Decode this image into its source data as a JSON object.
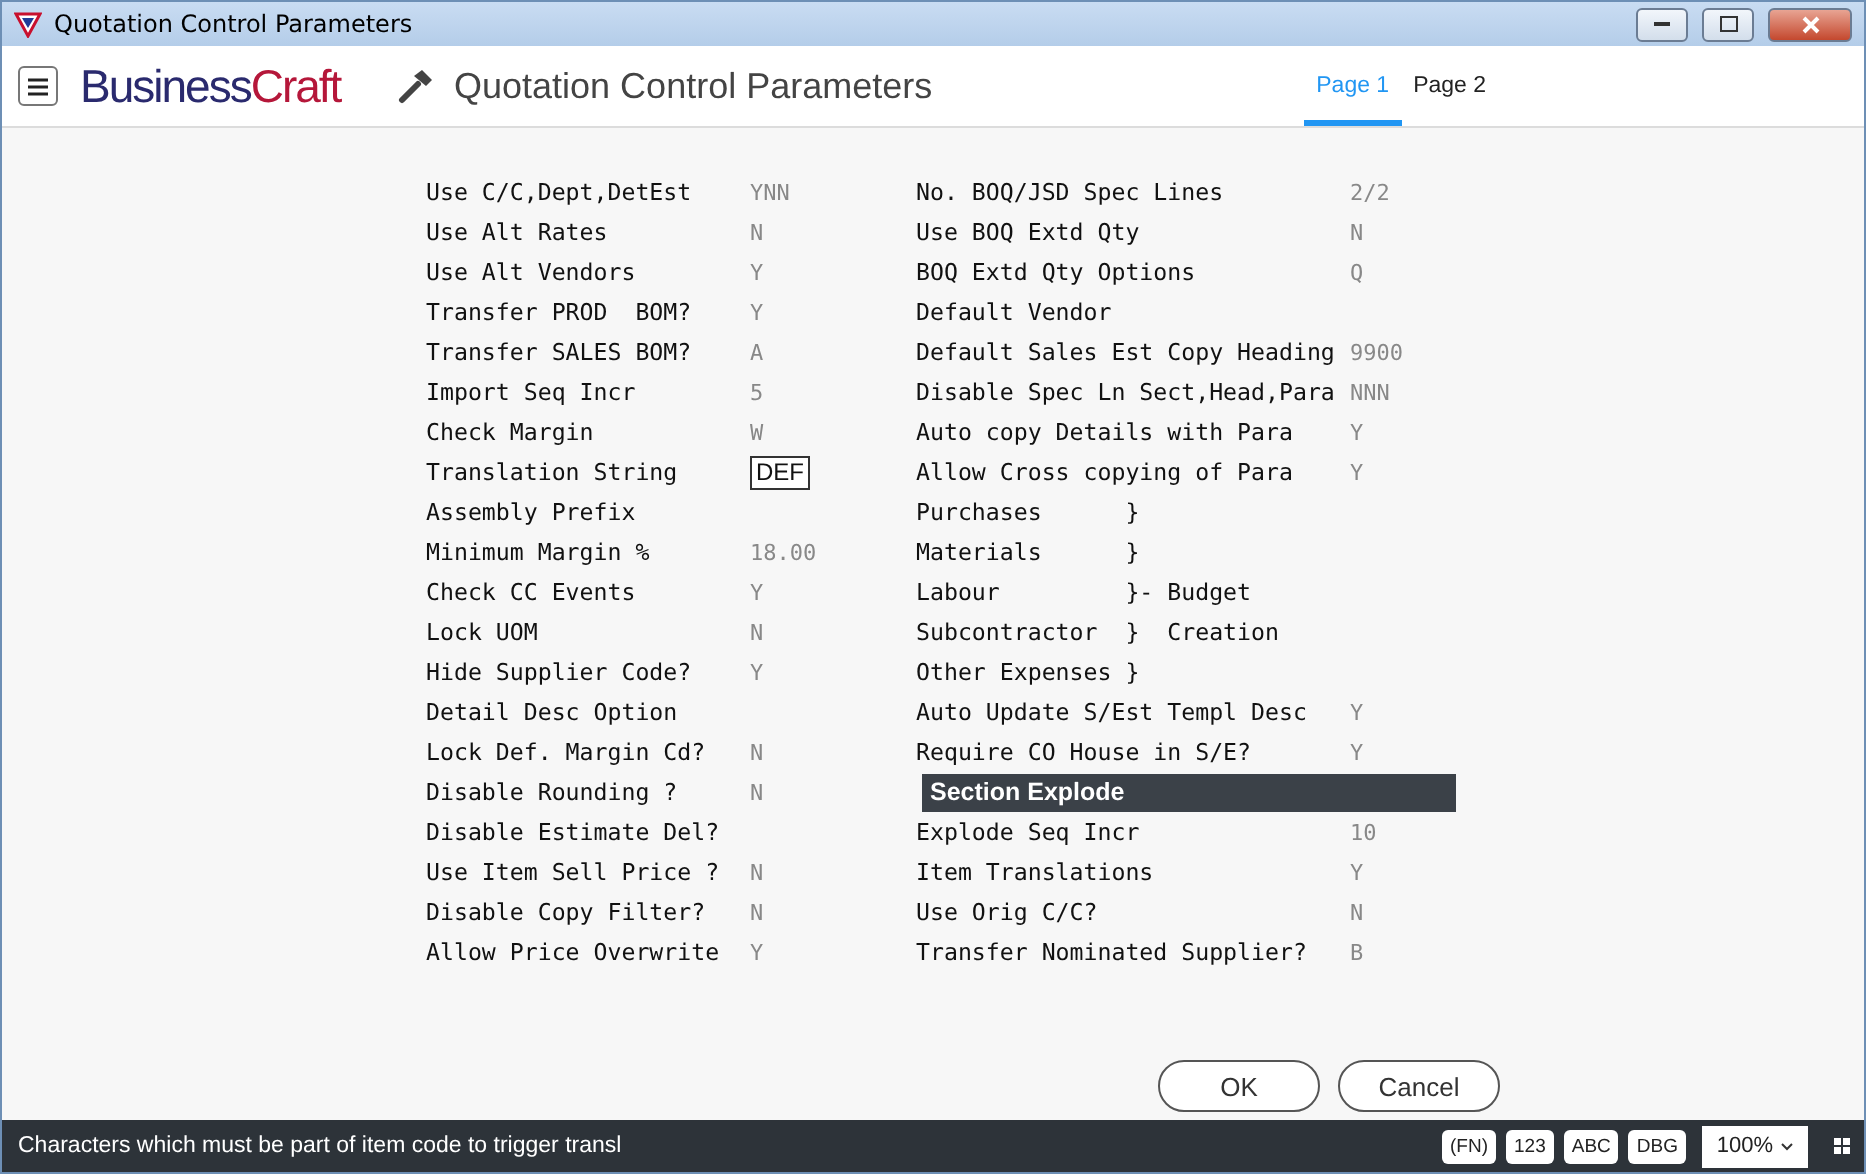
{
  "window": {
    "title": "Quotation Control Parameters"
  },
  "header": {
    "brand_first": "Business",
    "brand_second": "Craft",
    "title": "Quotation Control Parameters"
  },
  "tabs": [
    {
      "label": "Page 1",
      "selected": true
    },
    {
      "label": "Page 2",
      "selected": false
    }
  ],
  "left_rows": [
    {
      "kind": "param",
      "label": "Use C/C,Dept,DetEst",
      "value": "YNN"
    },
    {
      "kind": "param",
      "label": "Use Alt Rates",
      "value": "N"
    },
    {
      "kind": "param",
      "label": "Use Alt Vendors",
      "value": "Y"
    },
    {
      "kind": "param",
      "label": "Transfer PROD  BOM?",
      "value": "Y"
    },
    {
      "kind": "param",
      "label": "Transfer SALES BOM?",
      "value": "A"
    },
    {
      "kind": "param",
      "label": "Import Seq Incr",
      "value": "5"
    },
    {
      "kind": "param",
      "label": "Check Margin",
      "value": "W"
    },
    {
      "kind": "field",
      "label": "Translation String",
      "value": "DEF"
    },
    {
      "kind": "param",
      "label": "Assembly Prefix"
    },
    {
      "kind": "param",
      "label": "Minimum Margin %",
      "value": "18.00"
    },
    {
      "kind": "param",
      "label": "Check CC Events",
      "value": "Y"
    },
    {
      "kind": "param",
      "label": "Lock UOM",
      "value": "N"
    },
    {
      "kind": "param",
      "label": "Hide Supplier Code?",
      "value": "Y"
    },
    {
      "kind": "param",
      "label": "Detail Desc Option"
    },
    {
      "kind": "param",
      "label": "Lock Def. Margin Cd?",
      "value": "N"
    },
    {
      "kind": "param",
      "label": "Disable Rounding ?",
      "value": "N"
    },
    {
      "kind": "param",
      "label": "Disable Estimate Del?"
    },
    {
      "kind": "param",
      "label": "Use Item Sell Price ?",
      "value": "N"
    },
    {
      "kind": "param",
      "label": "Disable Copy Filter?",
      "value": "N"
    },
    {
      "kind": "param",
      "label": "Allow Price Overwrite",
      "value": "Y"
    }
  ],
  "right_rows": [
    {
      "kind": "param",
      "label": "No. BOQ/JSD Spec Lines",
      "value": "2/2"
    },
    {
      "kind": "param",
      "label": "Use BOQ Extd Qty",
      "value": "N"
    },
    {
      "kind": "param",
      "label": "BOQ Extd Qty Options",
      "value": "Q"
    },
    {
      "kind": "param",
      "label": "Default Vendor"
    },
    {
      "kind": "param",
      "label": "Default Sales Est Copy Heading",
      "value": "9900"
    },
    {
      "kind": "param",
      "label": "Disable Spec Ln Sect,Head,Para",
      "value": "NNN"
    },
    {
      "kind": "param",
      "label": "Auto copy Details with Para",
      "value": "Y"
    },
    {
      "kind": "param",
      "label": "Allow Cross copying of Para",
      "value": "Y"
    },
    {
      "kind": "param",
      "label": "Purchases      }"
    },
    {
      "kind": "param",
      "label": "Materials      }"
    },
    {
      "kind": "param",
      "label": "Labour         }- Budget"
    },
    {
      "kind": "param",
      "label": "Subcontractor  }  Creation"
    },
    {
      "kind": "param",
      "label": "Other Expenses }"
    },
    {
      "kind": "param",
      "label": "Auto Update S/Est Templ Desc",
      "value": "Y"
    },
    {
      "kind": "param",
      "label": "Require CO House in S/E?",
      "value": "Y"
    },
    {
      "kind": "heading",
      "label": "Section Explode"
    },
    {
      "kind": "param",
      "label": "Explode Seq Incr",
      "value": "10"
    },
    {
      "kind": "param",
      "label": "Item Translations",
      "value": "Y"
    },
    {
      "kind": "param",
      "label": "Use Orig C/C?",
      "value": "N"
    },
    {
      "kind": "param",
      "label": "Transfer Nominated Supplier?",
      "value": "B"
    }
  ],
  "buttons": [
    "OK",
    "Cancel"
  ],
  "status_bar": {
    "message": "Characters which must be part of item code to trigger transl",
    "chips": [
      "(FN)",
      "123",
      "ABC",
      "DBG"
    ],
    "zoom": "100%"
  }
}
